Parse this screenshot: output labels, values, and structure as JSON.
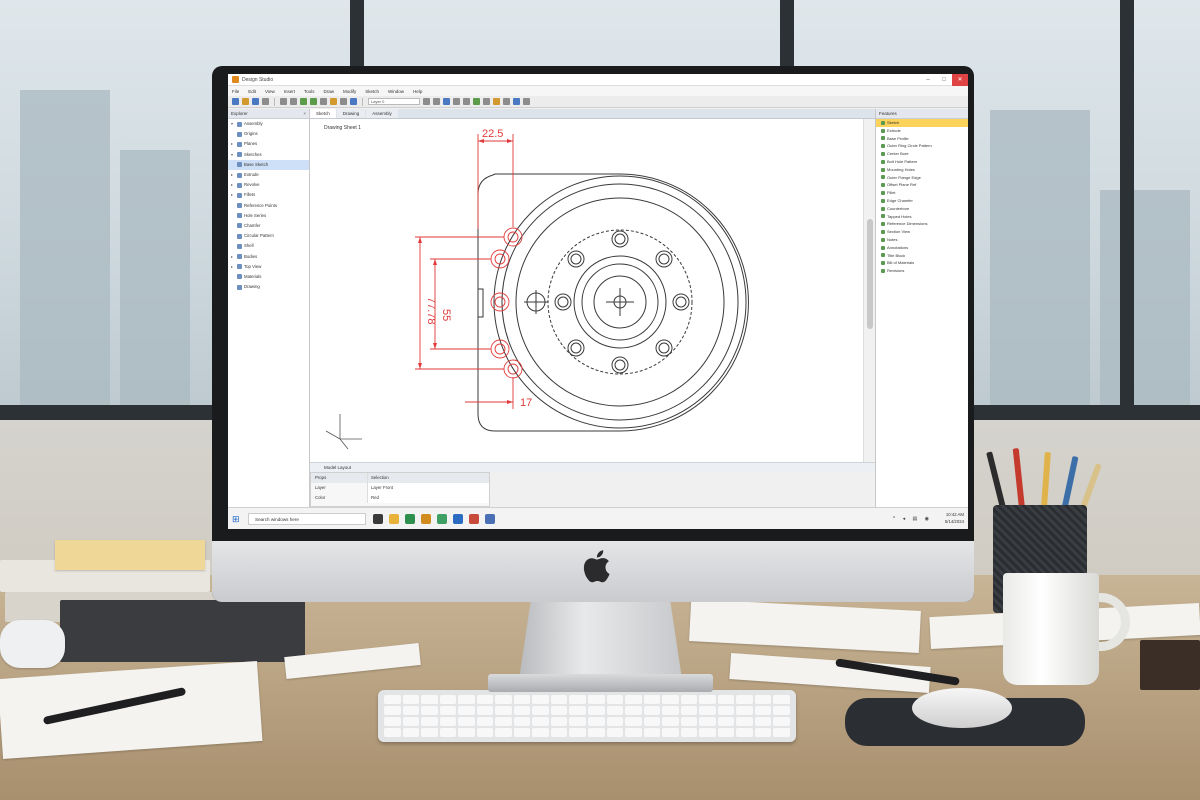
{
  "app": {
    "title": "Design Studio",
    "window_controls": [
      "–",
      "□",
      "✕"
    ]
  },
  "menu": [
    "File",
    "Edit",
    "View",
    "Insert",
    "Tools",
    "Draw",
    "Modify",
    "Sketch",
    "Window",
    "Help"
  ],
  "toolbar": {
    "layer_input": "Layer 0"
  },
  "left_panel": {
    "title": "Explorer",
    "items": [
      {
        "label": "Assembly",
        "arrow": "▾"
      },
      {
        "label": "Origins",
        "arrow": ""
      },
      {
        "label": "Planes",
        "arrow": "▸"
      },
      {
        "label": "Sketches",
        "arrow": "▾"
      },
      {
        "label": "Base Sketch",
        "arrow": ""
      },
      {
        "label": "Extrude",
        "arrow": "▸"
      },
      {
        "label": "Revolve",
        "arrow": "▸"
      },
      {
        "label": "Fillets",
        "arrow": "▸"
      },
      {
        "label": "Reference Points",
        "arrow": ""
      },
      {
        "label": "Hole Series",
        "arrow": ""
      },
      {
        "label": "Chamfer",
        "arrow": ""
      },
      {
        "label": "Circular Pattern",
        "arrow": ""
      },
      {
        "label": "Shell",
        "arrow": ""
      },
      {
        "label": "Bodies",
        "arrow": "▸"
      },
      {
        "label": "Top View",
        "arrow": "▸"
      },
      {
        "label": "Materials",
        "arrow": ""
      },
      {
        "label": "Drawing",
        "arrow": ""
      }
    ]
  },
  "doc_tabs": [
    "Sketch",
    "Drawing",
    "Assembly"
  ],
  "canvas": {
    "label": "Drawing Sheet 1",
    "dims": {
      "top_width": "22.5",
      "inner_height": "55",
      "outer_height": "77.78",
      "offset": "17"
    }
  },
  "model_tabs": "Model Layout",
  "properties": {
    "header_key": "Props",
    "header_value": "Selection",
    "rows": [
      {
        "key": "Layer",
        "value": "Layer Front"
      },
      {
        "key": "Color",
        "value": "Red"
      }
    ]
  },
  "right_panel": {
    "title": "Features",
    "items": [
      {
        "label": "Sketch"
      },
      {
        "label": "Extrude"
      },
      {
        "label": "Base Profile"
      },
      {
        "label": "Outer Ring Circle Pattern"
      },
      {
        "label": "Center Bore"
      },
      {
        "label": "Bolt Hole Pattern"
      },
      {
        "label": "Mounting Holes"
      },
      {
        "label": "Outer Flange Edge"
      },
      {
        "label": "Offset Plane Ref"
      },
      {
        "label": "Fillet"
      },
      {
        "label": "Edge Chamfer"
      },
      {
        "label": "Counterbore"
      },
      {
        "label": "Tapped Holes"
      },
      {
        "label": "Reference Dimensions"
      },
      {
        "label": "Section View"
      },
      {
        "label": "Notes"
      },
      {
        "label": "Annotations"
      },
      {
        "label": "Title Block"
      },
      {
        "label": "Bill of Materials"
      },
      {
        "label": "Revisions"
      }
    ]
  },
  "taskbar": {
    "search": "Search windows here",
    "time": "10:42 AM",
    "date": "5/14/2024"
  },
  "colors": {
    "dimension": "#e03a3a",
    "linework": "#3a3a3a",
    "selection": "#fbd25a"
  }
}
